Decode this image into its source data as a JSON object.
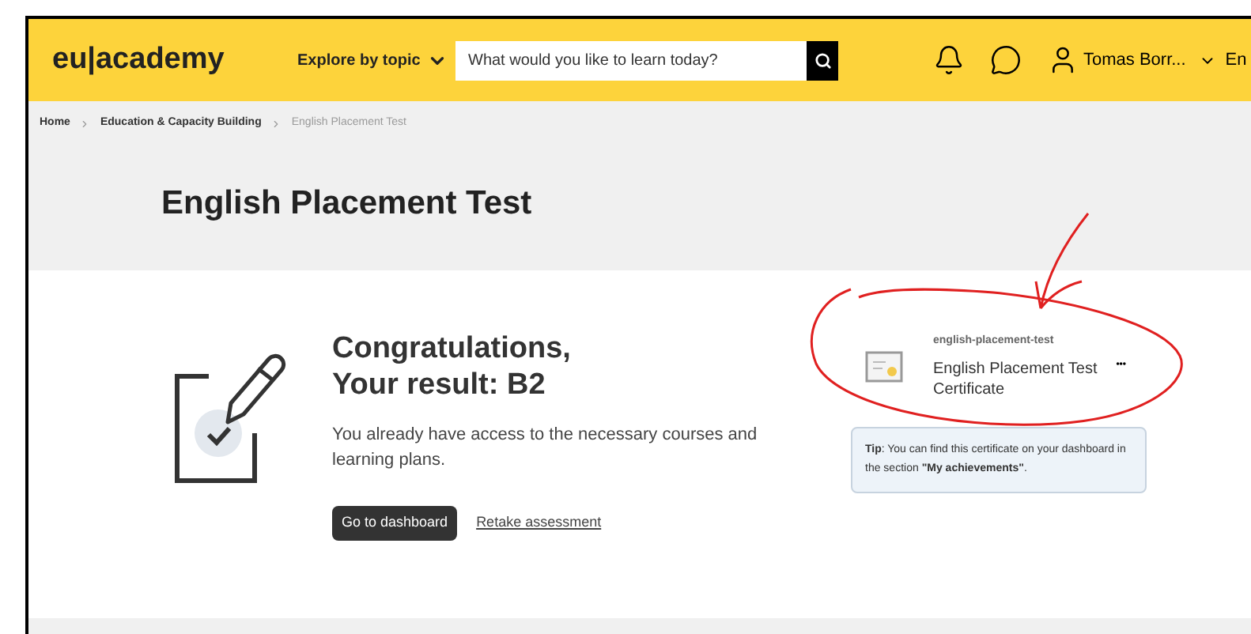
{
  "header": {
    "logo": "eu|academy",
    "explore": "Explore by topic",
    "search": {
      "placeholder": "What would you like to learn today?"
    },
    "user": "Tomas Borr...",
    "language": "En"
  },
  "breadcrumb": [
    {
      "label": "Home",
      "current": false
    },
    {
      "label": "Education & Capacity Building",
      "current": false
    },
    {
      "label": "English Placement Test",
      "current": true
    }
  ],
  "page_title": "English Placement Test",
  "result": {
    "heading_lines": [
      "Congratulations,",
      "Your result: B2"
    ],
    "message": "You already have access to the necessary courses and learning plans.",
    "primary_button": "Go to dashboard",
    "link": "Retake assessment"
  },
  "certificate": {
    "slug": "english-placement-test",
    "title": "English Placement Test Certificate",
    "menu": "•••"
  },
  "tip": "**Tip**: You can find this certificate on your dashboard in the section **\"My achievements\"**."
}
